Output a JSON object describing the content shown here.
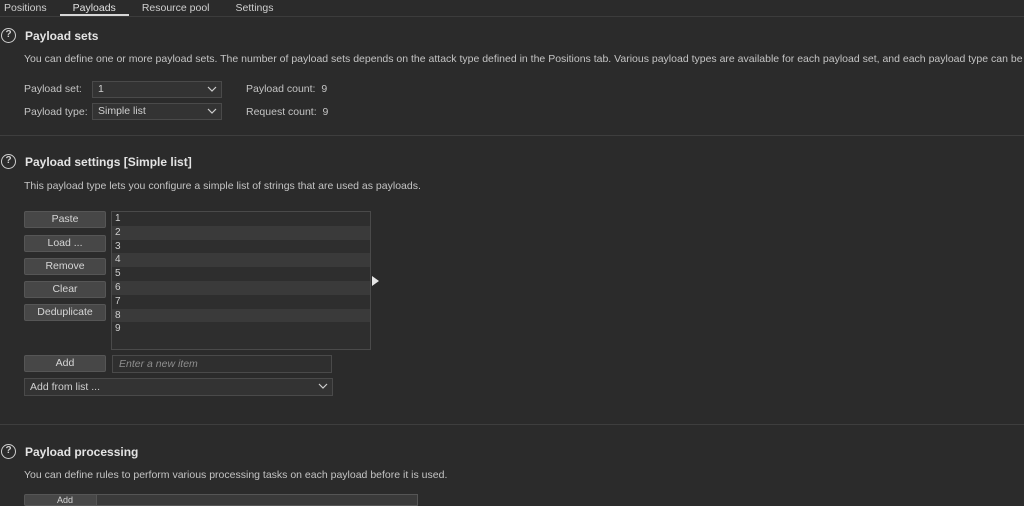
{
  "tabs": [
    "Positions",
    "Payloads",
    "Resource pool",
    "Settings"
  ],
  "payload_sets": {
    "title": "Payload sets",
    "description": "You can define one or more payload sets. The number of payload sets depends on the attack type defined in the Positions tab. Various payload types are available for each payload set, and each payload type can be cu",
    "set_label": "Payload set:",
    "set_value": "1",
    "type_label": "Payload type:",
    "type_value": "Simple list",
    "count_label": "Payload count:",
    "count_value": "9",
    "request_label": "Request count:",
    "request_value": "9"
  },
  "payload_settings": {
    "title": "Payload settings [Simple list]",
    "description": "This payload type lets you configure a simple list of strings that are used as payloads.",
    "buttons": {
      "paste": "Paste",
      "load": "Load ...",
      "remove": "Remove",
      "clear": "Clear",
      "deduplicate": "Deduplicate",
      "add": "Add"
    },
    "items": [
      "1",
      "2",
      "3",
      "4",
      "5",
      "6",
      "7",
      "8",
      "9"
    ],
    "new_item_placeholder": "Enter a new item",
    "add_from_list": "Add from list ..."
  },
  "payload_processing": {
    "title": "Payload processing",
    "description": "You can define rules to perform various processing tasks on each payload before it is used.",
    "add_label": "Add"
  }
}
